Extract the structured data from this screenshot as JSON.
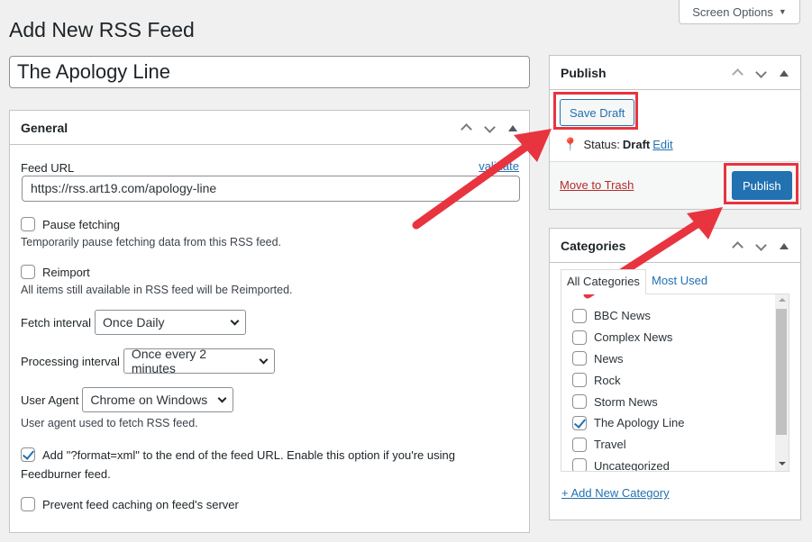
{
  "screen_options": "Screen Options",
  "page_title": "Add New RSS Feed",
  "post_title": "The Apology Line",
  "general": {
    "title": "General",
    "feed_url_label": "Feed URL",
    "validate": "validate",
    "feed_url": "https://rss.art19.com/apology-line",
    "pause_label": "Pause fetching",
    "pause_desc": "Temporarily pause fetching data from this RSS feed.",
    "reimport_label": "Reimport",
    "reimport_desc": "All items still available in RSS feed will be Reimported.",
    "fetch_interval_label": "Fetch interval",
    "fetch_interval": "Once Daily",
    "processing_interval_label": "Processing interval",
    "processing_interval": "Once every 2 minutes",
    "user_agent_label": "User Agent",
    "user_agent": "Chrome on Windows",
    "user_agent_desc": "User agent used to fetch RSS feed.",
    "format_label": "Add \"?format=xml\" to the end of the feed URL. Enable this option if you're using",
    "format_label2": "Feedburner feed.",
    "format_checked": true,
    "prevent_label": "Prevent feed caching on feed's server"
  },
  "publish": {
    "title": "Publish",
    "save_draft": "Save Draft",
    "status_label": "Status:",
    "status": "Draft",
    "edit": "Edit",
    "trash": "Move to Trash",
    "publish": "Publish"
  },
  "categories": {
    "title": "Categories",
    "tab_all": "All Categories",
    "tab_most": "Most Used",
    "items": [
      {
        "label": "BBC News",
        "checked": false
      },
      {
        "label": "Complex News",
        "checked": false
      },
      {
        "label": "News",
        "checked": false
      },
      {
        "label": "Rock",
        "checked": false
      },
      {
        "label": "Storm News",
        "checked": false
      },
      {
        "label": "The Apology Line",
        "checked": true
      },
      {
        "label": "Travel",
        "checked": false
      },
      {
        "label": "Uncategorized",
        "checked": false
      }
    ],
    "add_new": "+ Add New Category"
  },
  "colors": {
    "accent": "#2271b1",
    "annotation": "#e8343f",
    "trash": "#b32d2e"
  }
}
